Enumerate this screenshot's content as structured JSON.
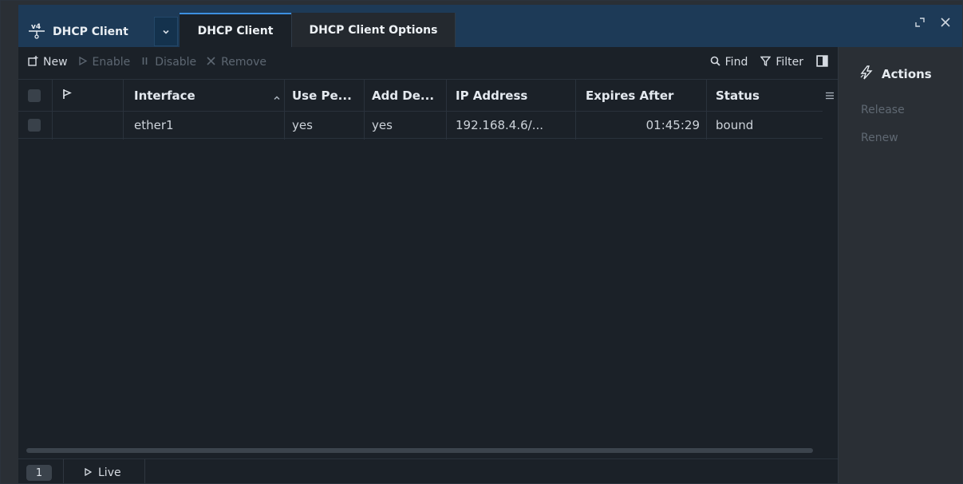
{
  "window": {
    "title": "DHCP Client",
    "tabs": [
      {
        "label": "DHCP Client",
        "active": true
      },
      {
        "label": "DHCP Client Options",
        "active": false
      }
    ],
    "icons": {
      "app": "dhcp-v4-icon",
      "dropdown": "chevron-down-icon",
      "restore": "restore-icon",
      "close": "close-icon"
    }
  },
  "toolbar": {
    "new_label": "New",
    "enable_label": "Enable",
    "disable_label": "Disable",
    "remove_label": "Remove",
    "find_label": "Find",
    "filter_label": "Filter"
  },
  "table": {
    "columns": {
      "interface": "Interface",
      "use_peer": "Use Pe...",
      "add_default": "Add De...",
      "ip_address": "IP Address",
      "expires_after": "Expires After",
      "status": "Status"
    },
    "sort": {
      "column": "interface",
      "direction": "ascending"
    },
    "rows": [
      {
        "interface": "ether1",
        "use_peer": "yes",
        "add_default": "yes",
        "ip_address": "192.168.4.6/...",
        "expires_after": "01:45:29",
        "status": "bound"
      }
    ]
  },
  "actions": {
    "title": "Actions",
    "release_label": "Release",
    "renew_label": "Renew"
  },
  "statusbar": {
    "count": "1",
    "live_label": "Live"
  },
  "colors": {
    "titlebar": "#1d3a57",
    "active_tab_accent": "#3d8fe0",
    "background": "#1b2128",
    "disabled_text": "#5d6772"
  }
}
